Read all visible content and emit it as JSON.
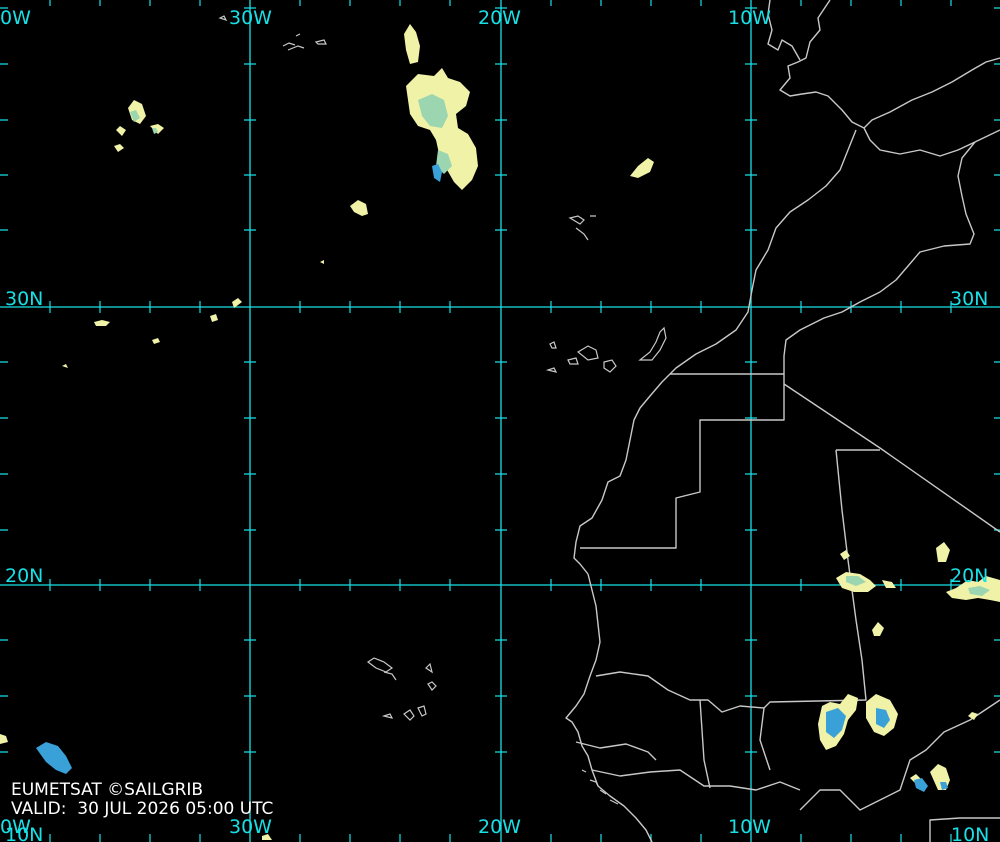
{
  "map": {
    "provider_credit": "EUMETSAT ©SAILGRIB",
    "valid_label": "VALID:",
    "valid_time": "30 JUL 2026 05:00 UTC",
    "colors": {
      "background": "#000000",
      "graticule": "#18e0e6",
      "coastline": "#c8c8c8",
      "cloud_light": "#f0f2a8",
      "cloud_mid": "#9cd6b0",
      "cloud_deep": "#3aa0d8"
    },
    "longitude_labels": {
      "w40_top": "0W",
      "w30_top": "30W",
      "w20_top": "20W",
      "w10_top": "10W",
      "w40_bottom": "0W",
      "w30_bottom": "30W",
      "w20_bottom": "20W",
      "w10_bottom": "10W"
    },
    "latitude_labels": {
      "n30_left": "30N",
      "n30_right": "30N",
      "n20_left": "20N",
      "n20_right": "20N",
      "n10_left": "10N",
      "n10_right": "10N"
    }
  }
}
